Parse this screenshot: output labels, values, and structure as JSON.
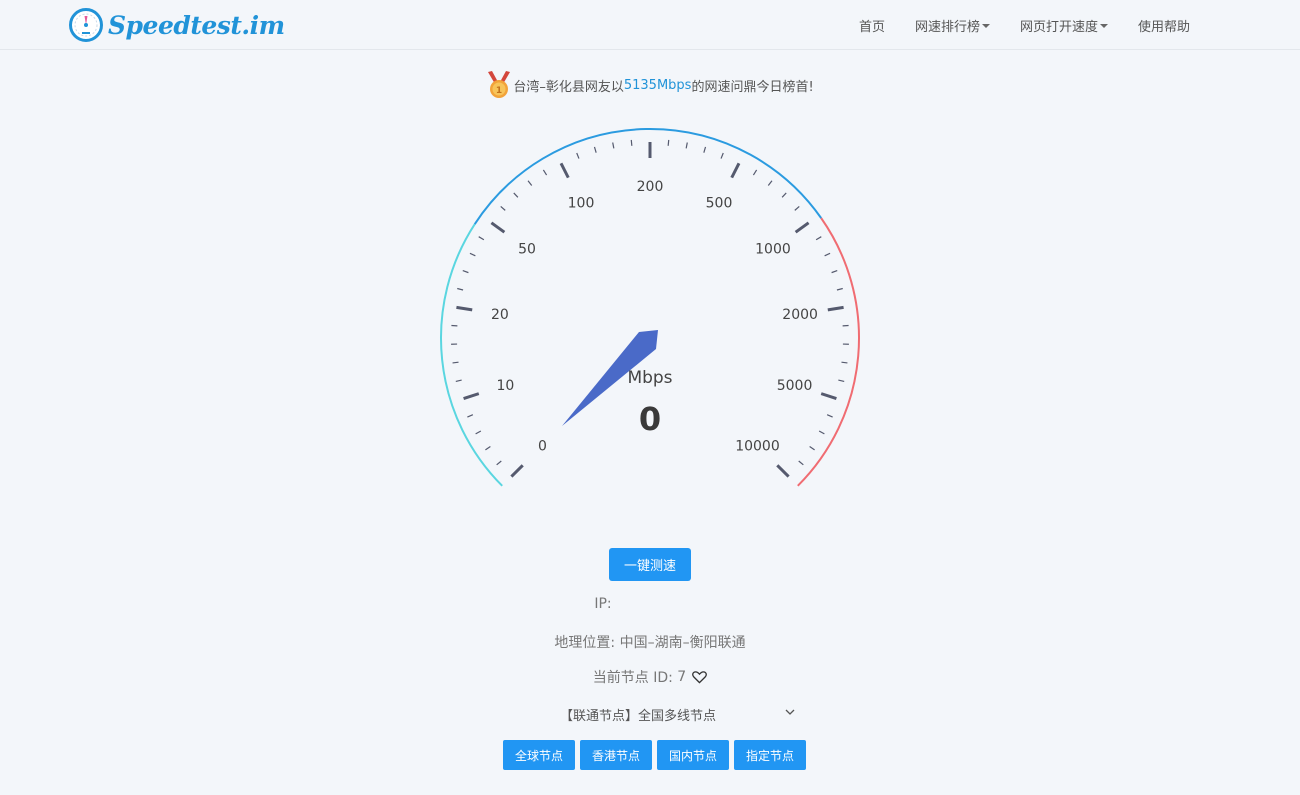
{
  "header": {
    "logo_text": "Speedtest.im",
    "nav": [
      {
        "label": "首页",
        "dropdown": false
      },
      {
        "label": "网速排行榜",
        "dropdown": true
      },
      {
        "label": "网页打开速度",
        "dropdown": true
      },
      {
        "label": "使用帮助",
        "dropdown": false
      }
    ]
  },
  "banner": {
    "prefix": "台湾–彰化县网友以",
    "highlight": "5135Mbps",
    "suffix": "的网速问鼎今日榜首!"
  },
  "gauge": {
    "unit": "Mbps",
    "value": "0",
    "needle_value": 0,
    "scale_labels": [
      "0",
      "10",
      "20",
      "50",
      "100",
      "200",
      "500",
      "1000",
      "2000",
      "5000",
      "10000"
    ],
    "colors": {
      "arc_left": "#5ad6e0",
      "arc_top": "#2b9be0",
      "arc_right": "#f06c72",
      "needle": "#4a6ac8",
      "ticks": "#555a6e"
    }
  },
  "actions": {
    "start_button": "一键测速"
  },
  "info": {
    "ip_label": "IP:",
    "ip_value": "",
    "geo_label": "地理位置:",
    "geo_value": "中国–湖南–衡阳联通",
    "node_label": "当前节点 ID:",
    "node_id": "7"
  },
  "node_select": {
    "selected": "【联通节点】全国多线节点"
  },
  "node_buttons": [
    "全球节点",
    "香港节点",
    "国内节点",
    "指定节点"
  ],
  "colors": {
    "accent": "#2196f3",
    "brand": "#2193d8"
  }
}
